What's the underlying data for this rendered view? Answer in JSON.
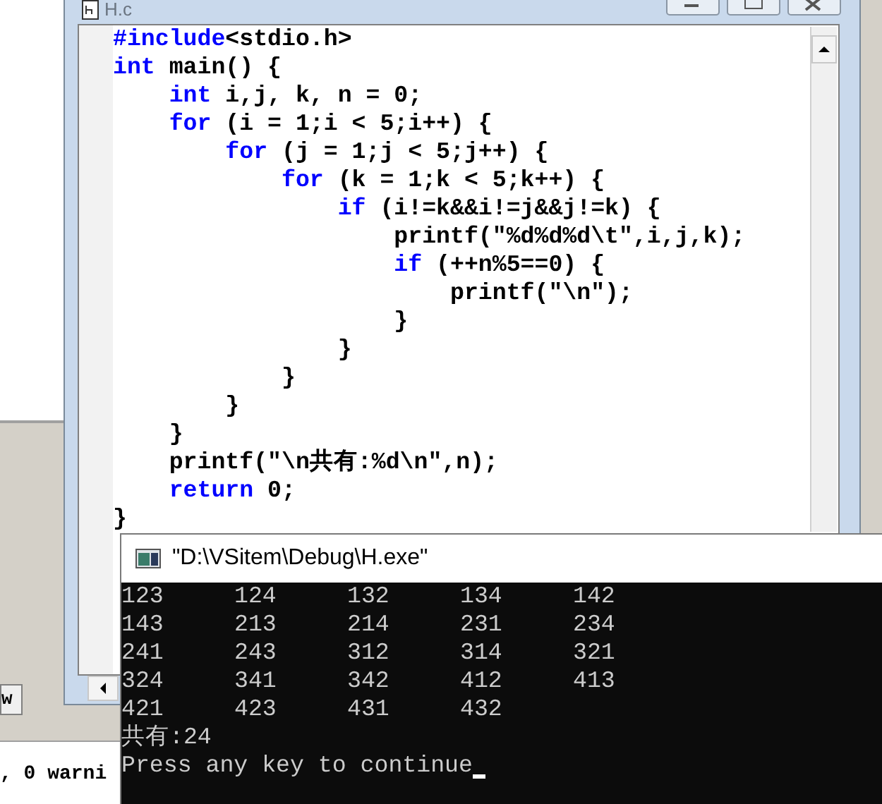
{
  "left_tab": {
    "label": "w"
  },
  "editor": {
    "title": "H.c",
    "lines": [
      [
        {
          "text": "#include",
          "kind": "keyword"
        },
        {
          "text": "<stdio.h>",
          "kind": "plain"
        }
      ],
      [
        {
          "text": "int",
          "kind": "keyword"
        },
        {
          "text": " main() {",
          "kind": "plain"
        }
      ],
      [
        {
          "text": "    int",
          "kind": "keyword"
        },
        {
          "text": " i,j, k, n = 0;",
          "kind": "plain"
        }
      ],
      [
        {
          "text": "    for",
          "kind": "keyword"
        },
        {
          "text": " (i = 1;i < 5;i++) {",
          "kind": "plain"
        }
      ],
      [
        {
          "text": "        for",
          "kind": "keyword"
        },
        {
          "text": " (j = 1;j < 5;j++) {",
          "kind": "plain"
        }
      ],
      [
        {
          "text": "            for",
          "kind": "keyword"
        },
        {
          "text": " (k = 1;k < 5;k++) {",
          "kind": "plain"
        }
      ],
      [
        {
          "text": "                if",
          "kind": "keyword"
        },
        {
          "text": " (i!=k&&i!=j&&j!=k) {",
          "kind": "plain"
        }
      ],
      [
        {
          "text": "                    printf(\"%d%d%d\\t\",i,j,k);",
          "kind": "plain"
        }
      ],
      [
        {
          "text": "                    if",
          "kind": "keyword"
        },
        {
          "text": " (++n%5==0) {",
          "kind": "plain"
        }
      ],
      [
        {
          "text": "                        printf(\"\\n\");",
          "kind": "plain"
        }
      ],
      [
        {
          "text": "                    }",
          "kind": "plain"
        }
      ],
      [
        {
          "text": "                }",
          "kind": "plain"
        }
      ],
      [
        {
          "text": "            }",
          "kind": "plain"
        }
      ],
      [
        {
          "text": "        }",
          "kind": "plain"
        }
      ],
      [
        {
          "text": "    }",
          "kind": "plain"
        }
      ],
      [
        {
          "text": "    printf(\"\\n共有:%d\\n\",n);",
          "kind": "plain"
        }
      ],
      [
        {
          "text": "    return",
          "kind": "keyword"
        },
        {
          "text": " 0;",
          "kind": "plain"
        }
      ],
      [
        {
          "text": "}",
          "kind": "plain"
        }
      ]
    ]
  },
  "output_pane": {
    "text": ", 0 warni"
  },
  "console": {
    "title": "\"D:\\VSitem\\Debug\\H.exe\"",
    "rows": [
      {
        "kind": "table",
        "cells": [
          "123",
          "124",
          "132",
          "134",
          "142"
        ]
      },
      {
        "kind": "table",
        "cells": [
          "143",
          "213",
          "214",
          "231",
          "234"
        ]
      },
      {
        "kind": "table",
        "cells": [
          "241",
          "243",
          "312",
          "314",
          "321"
        ]
      },
      {
        "kind": "table",
        "cells": [
          "324",
          "341",
          "342",
          "412",
          "413"
        ]
      },
      {
        "kind": "table",
        "cells": [
          "421",
          "423",
          "431",
          "432"
        ]
      },
      {
        "kind": "text",
        "text": "共有:24"
      },
      {
        "kind": "prompt",
        "text": "Press any key to continue"
      }
    ]
  }
}
